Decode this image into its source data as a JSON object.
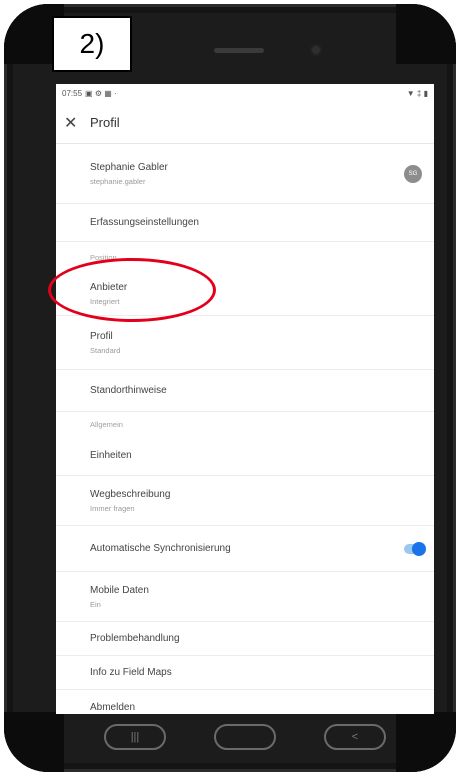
{
  "step_label": "2)",
  "status_bar": {
    "time": "07:55",
    "left_icons": "▣ ⚙ ▦ ·",
    "right_icons": "▼ ‡ ▮"
  },
  "appbar": {
    "close_glyph": "✕",
    "title": "Profil"
  },
  "account": {
    "name": "Stephanie Gabler",
    "username": "stephanie.gabler",
    "avatar_initials": "SG"
  },
  "items": {
    "capture_settings": "Erfassungseinstellungen",
    "position_header": "Position",
    "provider": {
      "title": "Anbieter",
      "value": "Integriert"
    },
    "profile": {
      "title": "Profil",
      "value": "Standard"
    },
    "location_notes": "Standorthinweise",
    "general_header": "Allgemein",
    "units": "Einheiten",
    "directions": {
      "title": "Wegbeschreibung",
      "value": "Immer fragen"
    },
    "auto_sync": {
      "title": "Automatische Synchronisierung",
      "enabled": true
    },
    "mobile_data": {
      "title": "Mobile Daten",
      "value": "Ein"
    },
    "troubleshooting": "Problembehandlung",
    "about": "Info zu Field Maps",
    "sign_out": "Abmelden"
  },
  "navbar": {
    "recent_glyph": "|||",
    "home_glyph": "",
    "back_glyph": "<"
  },
  "colors": {
    "highlight": "#e3001b",
    "toggle_on": "#1a73e8"
  }
}
